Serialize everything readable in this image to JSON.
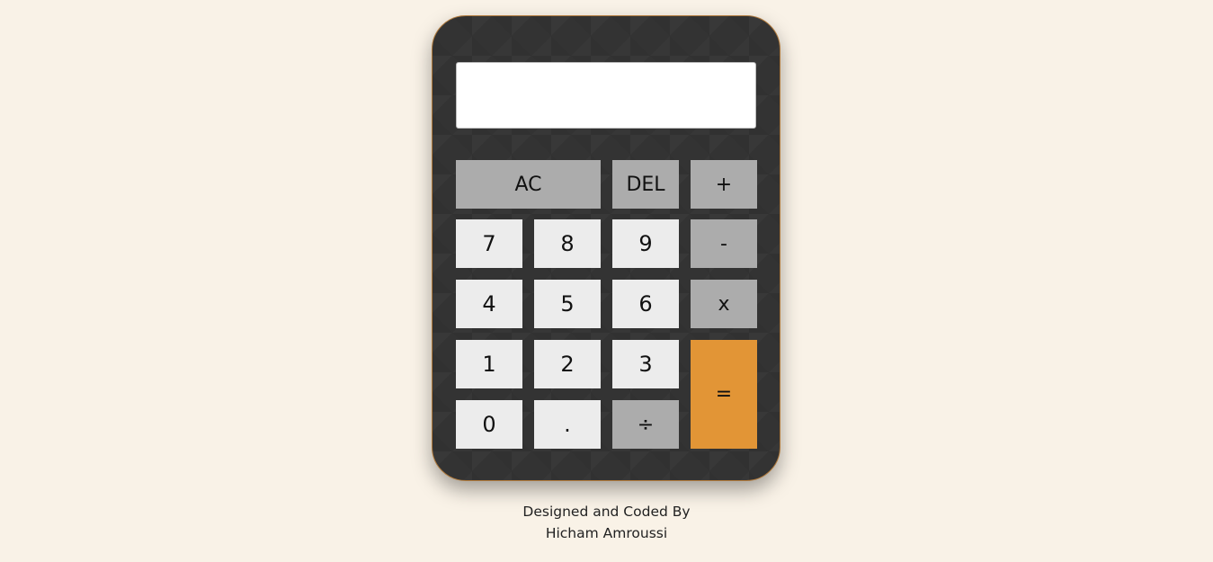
{
  "calculator": {
    "display_value": "",
    "keys": {
      "ac": "AC",
      "del": "DEL",
      "plus": "+",
      "seven": "7",
      "eight": "8",
      "nine": "9",
      "minus": "-",
      "four": "4",
      "five": "5",
      "six": "6",
      "multiply": "x",
      "one": "1",
      "two": "2",
      "three": "3",
      "equals": "=",
      "zero": "0",
      "dot": ".",
      "divide": "÷"
    }
  },
  "footer": {
    "line1": "Designed and Coded By",
    "line2": "Hicham Amroussi"
  },
  "colors": {
    "page_background": "#f9f2e7",
    "body": "#333333",
    "number_key": "#ececec",
    "operator_key": "#acacac",
    "equals_key": "#e29536",
    "display": "#ffffff"
  }
}
